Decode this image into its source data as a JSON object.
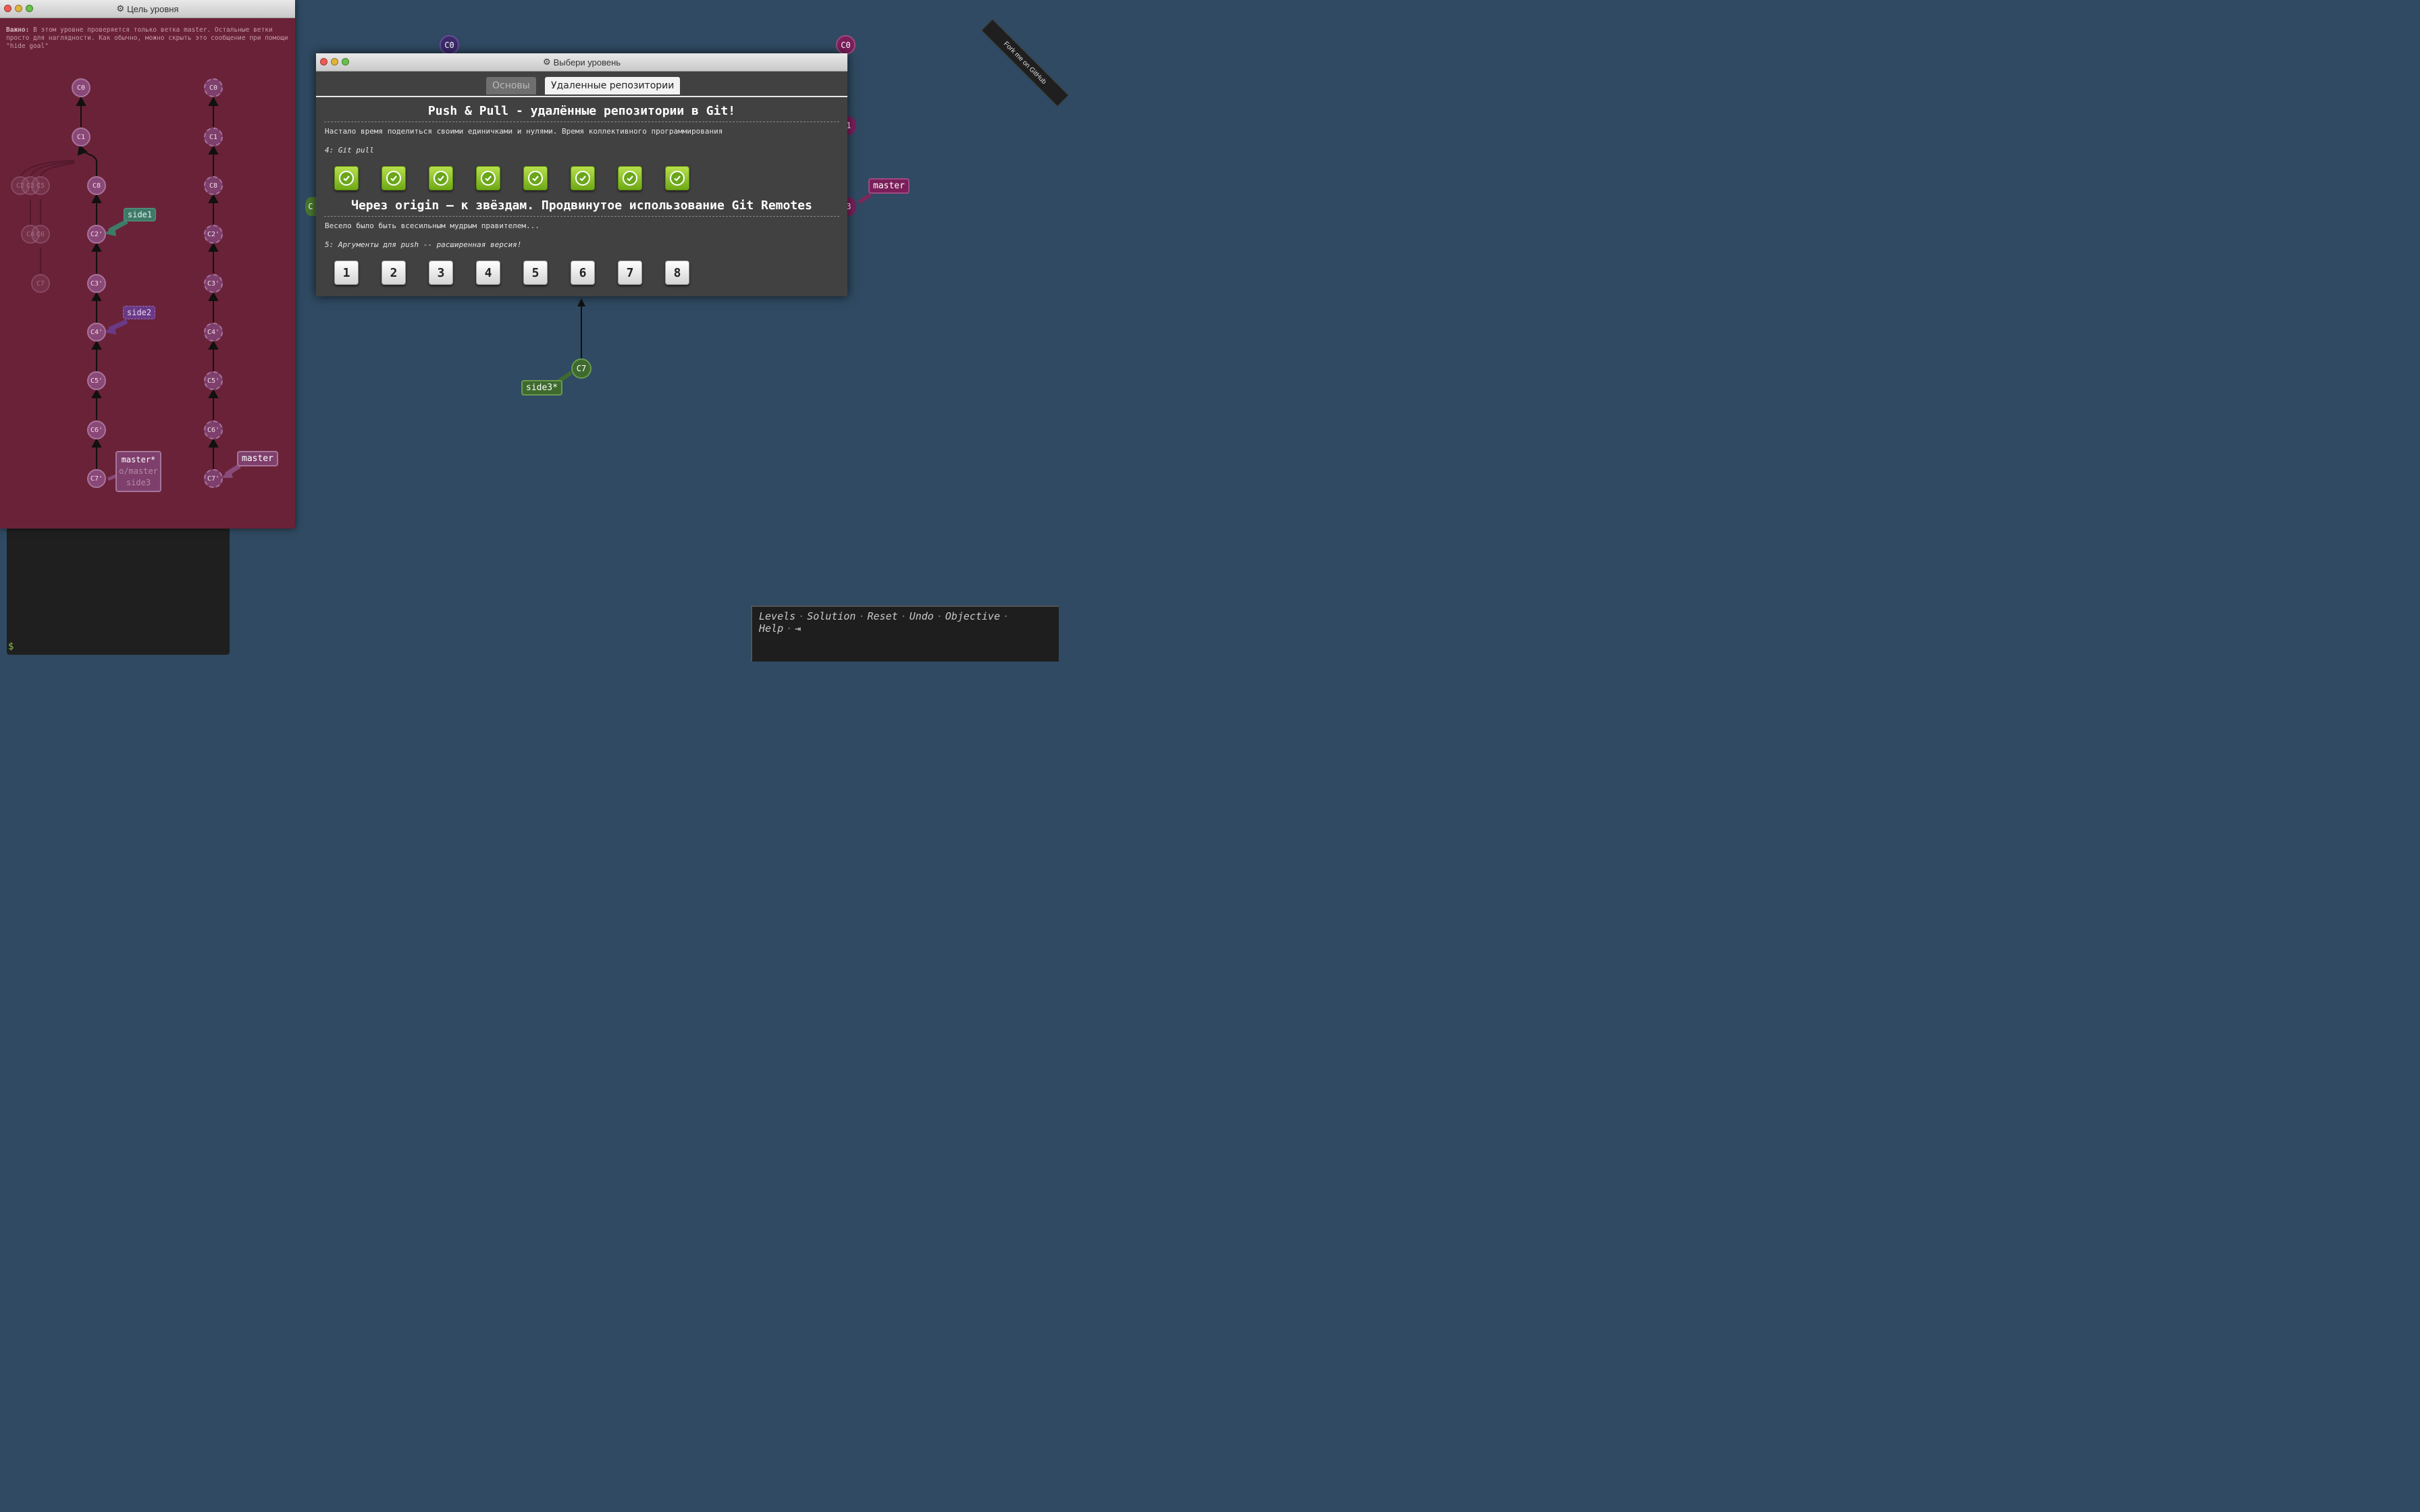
{
  "ribbon": {
    "label": "Fork me on GitHub"
  },
  "background_graph": {
    "nodes": {
      "c0_left": "C0",
      "c0_right": "C0",
      "c7": "C7",
      "partial_c1": "1",
      "partial_c": "C",
      "partial_c3": "3"
    },
    "labels": {
      "master": "master",
      "side3": "side3*"
    }
  },
  "terminal": {
    "prompt": "$"
  },
  "goal_window": {
    "title": "Цель уровня",
    "note_bold": "Важно:",
    "note_text": "В этом уровне проверяется только ветка master. Остальные ветки просто для наглядности. Как обычно, можно скрыть это сообщение при помощи \"hide goal\"",
    "left_column": {
      "nodes": [
        "C0",
        "C1",
        "C8",
        "C2'",
        "C3'",
        "C4'",
        "C5'",
        "C6'",
        "C7'"
      ],
      "ghost_nodes": [
        "C2",
        "C3",
        "C5",
        "C4",
        "C6",
        "C7"
      ],
      "tags": {
        "side1": "side1",
        "side2": "side2",
        "master": "master*",
        "o_master": "o/master",
        "side3": "side3"
      }
    },
    "right_column": {
      "nodes": [
        "C0",
        "C1",
        "C8",
        "C2'",
        "C3'",
        "C4'",
        "C5'",
        "C6'",
        "C7'"
      ],
      "tags": {
        "master": "master"
      }
    }
  },
  "level_window": {
    "title": "Выбери уровень",
    "tabs": [
      {
        "label": "Основы",
        "active": false
      },
      {
        "label": "Удаленные репозитории",
        "active": true
      }
    ],
    "sections": [
      {
        "title": "Push & Pull - удалённые репозитории в Git!",
        "description": "Настало время поделиться своими единичками и нулями. Время коллективного программирования",
        "selected_level": "4: Git pull",
        "levels": [
          "1",
          "2",
          "3",
          "4",
          "5",
          "6",
          "7",
          "8"
        ],
        "completed": true
      },
      {
        "title": "Через origin – к звёздам. Продвинутое использование Git Remotes",
        "description": "Весело было быть всесильным мудрым правителем...",
        "selected_level": "5: Аргументы для push -- расширенная версия!",
        "levels": [
          "1",
          "2",
          "3",
          "4",
          "5",
          "6",
          "7",
          "8"
        ],
        "completed": false
      }
    ]
  },
  "command_bar": {
    "items": [
      "Levels",
      "Solution",
      "Reset",
      "Undo",
      "Objective",
      "Help"
    ],
    "separator": "·"
  },
  "colors": {
    "background": "#2f4a62",
    "goal_bg": "#6a2238",
    "success": "#6fa816"
  }
}
